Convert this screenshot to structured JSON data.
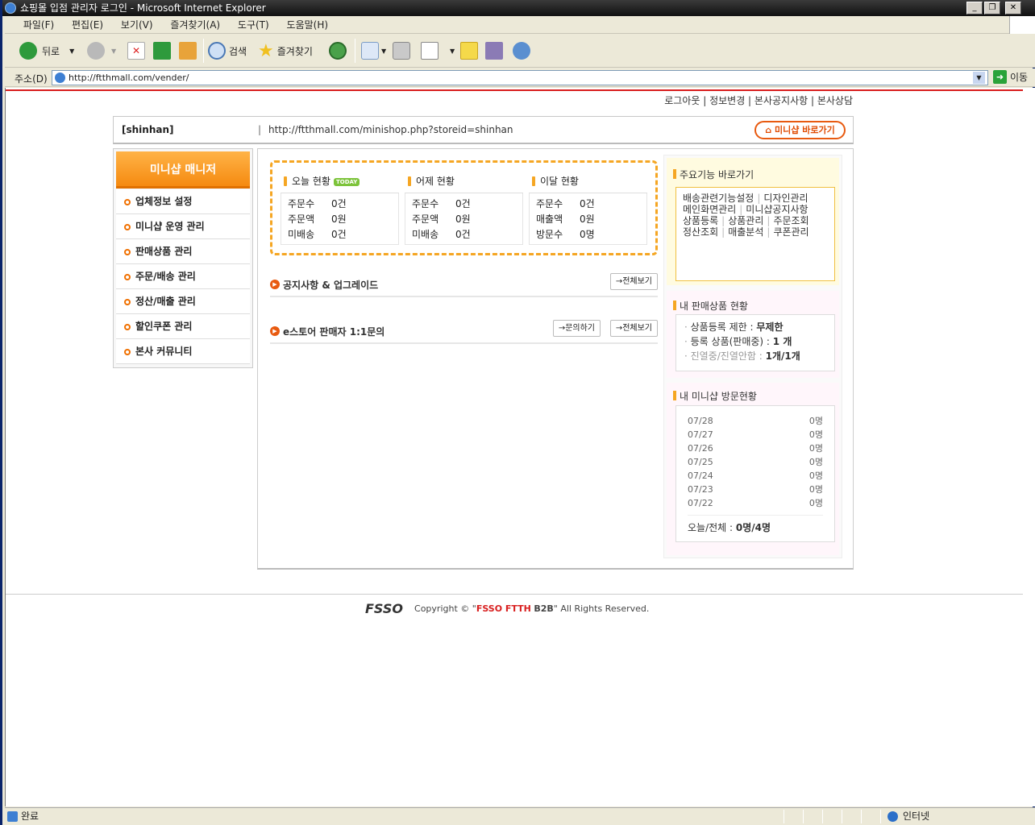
{
  "window": {
    "title": "쇼핑몰 입점 관리자 로그인 - Microsoft Internet Explorer"
  },
  "menu": [
    "파일(F)",
    "편집(E)",
    "보기(V)",
    "즐겨찾기(A)",
    "도구(T)",
    "도움말(H)"
  ],
  "toolbar": {
    "back": "뒤로",
    "search": "검색",
    "favorites": "즐겨찾기"
  },
  "address": {
    "label": "주소(D)",
    "url": "http://ftthmall.com/vender/",
    "go": "이동"
  },
  "toplinks": "로그아웃 | 정보변경 | 본사공지사항 | 본사상담",
  "store": {
    "id": "[shinhan]",
    "sep": "|",
    "url": "http://ftthmall.com/minishop.php?storeid=shinhan",
    "button": "미니샵 바로가기"
  },
  "sidebar": {
    "title": "미니샵 매니저",
    "items": [
      "업체정보 설정",
      "미니샵 운영 관리",
      "판매상품 관리",
      "주문/배송 관리",
      "정산/매출 관리",
      "할인쿠폰 관리",
      "본사 커뮤니티"
    ]
  },
  "stats": [
    {
      "title": "오늘 현황",
      "badge": "TODAY",
      "rows": [
        [
          "주문수",
          "0건"
        ],
        [
          "주문액",
          "0원"
        ],
        [
          "미배송",
          "0건"
        ]
      ]
    },
    {
      "title": "어제 현황",
      "rows": [
        [
          "주문수",
          "0건"
        ],
        [
          "주문액",
          "0원"
        ],
        [
          "미배송",
          "0건"
        ]
      ]
    },
    {
      "title": "이달 현황",
      "rows": [
        [
          "주문수",
          "0건"
        ],
        [
          "매출액",
          "0원"
        ],
        [
          "방문수",
          "0명"
        ]
      ]
    }
  ],
  "notice": {
    "title": "공지사항 & 업그레이드",
    "viewall": "→전체보기"
  },
  "qna": {
    "title": "e스토어 판매자 1:1문의",
    "ask": "→문의하기",
    "viewall": "→전체보기"
  },
  "quick": {
    "title": "주요기능 바로가기",
    "links": [
      "배송관련기능설정",
      "디자인관리",
      "메인화면관리",
      "미니샵공지사항",
      "상품등록",
      "상품관리",
      "주문조회",
      "정산조회",
      "매출분석",
      "쿠폰관리"
    ]
  },
  "goods": {
    "title": "내 판매상품 현황",
    "limit_label": "상품등록 제한 :",
    "limit_value": "무제한",
    "reg_label": "등록 상품(판매중) :",
    "reg_value": "1 개",
    "disp_label": "진열중/진열안함 :",
    "disp_value": "1개/1개"
  },
  "visits": {
    "title": "내 미니샵 방문현황",
    "rows": [
      [
        "07/28",
        "0명"
      ],
      [
        "07/27",
        "0명"
      ],
      [
        "07/26",
        "0명"
      ],
      [
        "07/25",
        "0명"
      ],
      [
        "07/24",
        "0명"
      ],
      [
        "07/23",
        "0명"
      ],
      [
        "07/22",
        "0명"
      ]
    ],
    "sum_label": "오늘/전체 :",
    "sum_value": "0명/4명"
  },
  "footer": {
    "logo": "FSSO",
    "copyright_pre": "Copyright © \"",
    "brand": "FSSO FTTH",
    "b2b": "B2B",
    "copyright_post": "\" All Rights Reserved."
  },
  "status": {
    "text": "완료",
    "zone": "인터넷"
  }
}
